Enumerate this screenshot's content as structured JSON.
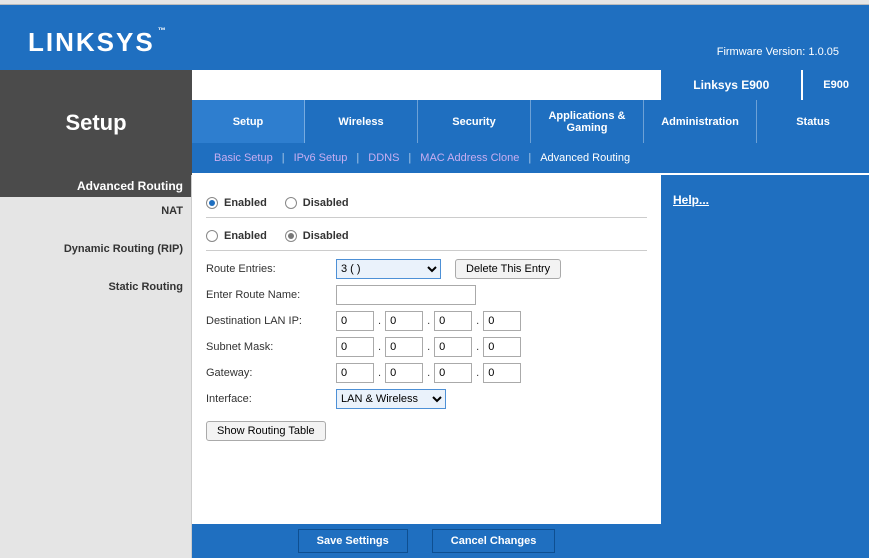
{
  "brand": "LINKSYS",
  "firmware_label": "Firmware Version: 1.0.05",
  "setup_box": "Setup",
  "product": {
    "name": "Linksys E900",
    "tag": "E900"
  },
  "main_tabs": [
    "Setup",
    "Wireless",
    "Security",
    "Applications & Gaming",
    "Administration",
    "Status"
  ],
  "sub_tabs": [
    "Basic Setup",
    "IPv6 Setup",
    "DDNS",
    "MAC Address Clone",
    "Advanced Routing"
  ],
  "left": {
    "title": "Advanced Routing",
    "items": [
      "NAT",
      "Dynamic Routing (RIP)",
      "Static Routing"
    ]
  },
  "nat": {
    "enabled": "Enabled",
    "disabled": "Disabled"
  },
  "rip": {
    "enabled": "Enabled",
    "disabled": "Disabled"
  },
  "form": {
    "route_entries_label": "Route Entries:",
    "route_entries_value": "3 ( )",
    "delete_btn": "Delete This Entry",
    "route_name_label": "Enter Route Name:",
    "route_name_value": "",
    "dst_label": "Destination LAN IP:",
    "dst": [
      "0",
      "0",
      "0",
      "0"
    ],
    "mask_label": "Subnet Mask:",
    "mask": [
      "0",
      "0",
      "0",
      "0"
    ],
    "gw_label": "Gateway:",
    "gw": [
      "0",
      "0",
      "0",
      "0"
    ],
    "iface_label": "Interface:",
    "iface_value": "LAN & Wireless",
    "show_table_btn": "Show Routing Table"
  },
  "buttons": {
    "save": "Save Settings",
    "cancel": "Cancel Changes"
  },
  "help": "Help..."
}
